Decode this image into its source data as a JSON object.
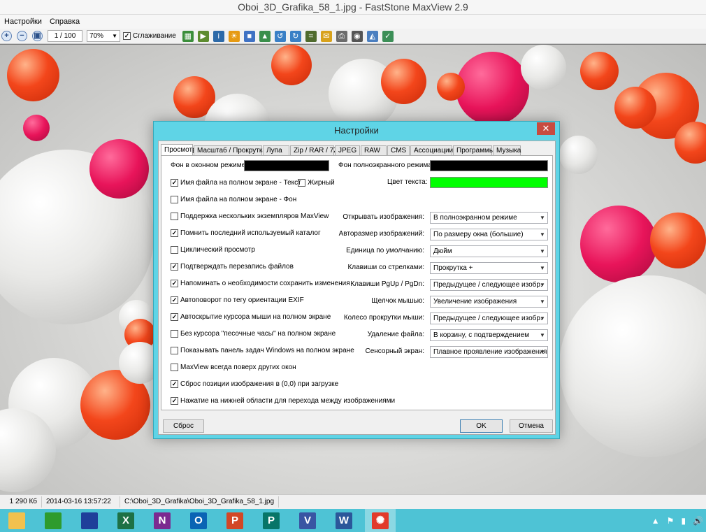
{
  "window": {
    "title": "Oboi_3D_Grafika_58_1.jpg - FastStone MaxView 2.9"
  },
  "menu": [
    "Настройки",
    "Справка"
  ],
  "toolbar": {
    "page": "1 / 100",
    "zoom": "70%",
    "smoothing_label": "Сглаживание",
    "smoothing_checked": true
  },
  "status": {
    "size": "1 290 Кб",
    "datetime": "2014-03-16 13:57:22",
    "path": "C:\\Oboi_3D_Grafika\\Oboi_3D_Grafika_58_1.jpg"
  },
  "dialog": {
    "title": "Настройки",
    "close": "✕",
    "tabs": [
      "Просмотр",
      "Масштаб / Прокрутка",
      "Лупа",
      "Zip / RAR / 7Z",
      "JPEG",
      "RAW",
      "CMS",
      "Ассоциации",
      "Программы",
      "Музыка"
    ],
    "active_tab": "Просмотр",
    "bg_window_label": "Фон в оконном режиме:",
    "bg_window_color": "#000000",
    "bg_full_label": "Фон полноэкранного режима:",
    "bg_full_color": "#000000",
    "text_color_label": "Цвет текста:",
    "text_color": "#00ff00",
    "checkboxes": [
      {
        "label": "Имя файла на полном экране - Текст",
        "checked": true
      },
      {
        "label": "Имя файла на полном экране - Фон",
        "checked": false
      },
      {
        "label": "Поддержка нескольких экземпляров MaxView",
        "checked": false
      },
      {
        "label": "Помнить последний используемый каталог",
        "checked": true
      },
      {
        "label": "Циклический просмотр",
        "checked": false
      },
      {
        "label": "Подтверждать перезапись файлов",
        "checked": true
      },
      {
        "label": "Напоминать о необходимости сохранить изменения",
        "checked": true
      },
      {
        "label": "Автоповорот по тегу ориентации EXIF",
        "checked": true
      },
      {
        "label": "Автоскрытие курсора мыши на полном экране",
        "checked": true
      },
      {
        "label": "Без курсора \"песочные часы\" на полном экране",
        "checked": false
      },
      {
        "label": "Показывать панель задач Windows на полном экране",
        "checked": false
      },
      {
        "label": "MaxView всегда поверх других окон",
        "checked": false
      },
      {
        "label": "Сброс позиции изображения в (0,0) при загрузке",
        "checked": true
      },
      {
        "label": "Нажатие на нижней области для перехода между изображениями",
        "checked": true
      }
    ],
    "bold": {
      "label": "Жирный",
      "checked": false
    },
    "dropdowns": [
      {
        "label": "Открывать изображения:",
        "value": "В полноэкранном режиме"
      },
      {
        "label": "Авторазмер изображений:",
        "value": "По размеру окна (большие)"
      },
      {
        "label": "Единица по умолчанию:",
        "value": "Дюйм"
      },
      {
        "label": "Клавиши со стрелками:",
        "value": "Прокрутка +"
      },
      {
        "label": "Клавиши PgUp / PgDn:",
        "value": "Предыдущее / следующее изобр."
      },
      {
        "label": "Щелчок мышью:",
        "value": "Увеличение изображения"
      },
      {
        "label": "Колесо прокрутки мыши:",
        "value": "Предыдущее / следующее изобр."
      },
      {
        "label": "Удаление файла:",
        "value": "В корзину, с подтверждением"
      },
      {
        "label": "Сенсорный экран:",
        "value": "Плавное проявление изображения"
      }
    ],
    "reset_button": "Сброс",
    "ok_button": "OK",
    "cancel_button": "Отмена"
  },
  "taskbar": {
    "apps": [
      {
        "name": "file-explorer",
        "glyph": "",
        "color": "#f2c14e"
      },
      {
        "name": "store",
        "glyph": "",
        "color": "#2e9b2e"
      },
      {
        "name": "save-app",
        "glyph": "",
        "color": "#1f3f9a"
      },
      {
        "name": "excel",
        "glyph": "X",
        "color": "#1e7145"
      },
      {
        "name": "onenote",
        "glyph": "N",
        "color": "#7b2a90"
      },
      {
        "name": "outlook",
        "glyph": "O",
        "color": "#0a64b4"
      },
      {
        "name": "powerpoint",
        "glyph": "P",
        "color": "#d24726"
      },
      {
        "name": "publisher",
        "glyph": "P",
        "color": "#077568"
      },
      {
        "name": "visio",
        "glyph": "V",
        "color": "#3955a3"
      },
      {
        "name": "word",
        "glyph": "W",
        "color": "#2b579a"
      },
      {
        "name": "maxview",
        "glyph": "✺",
        "color": "#e23a2b"
      }
    ],
    "tray": [
      "▲",
      "⚑",
      "▮",
      "🔊"
    ]
  }
}
